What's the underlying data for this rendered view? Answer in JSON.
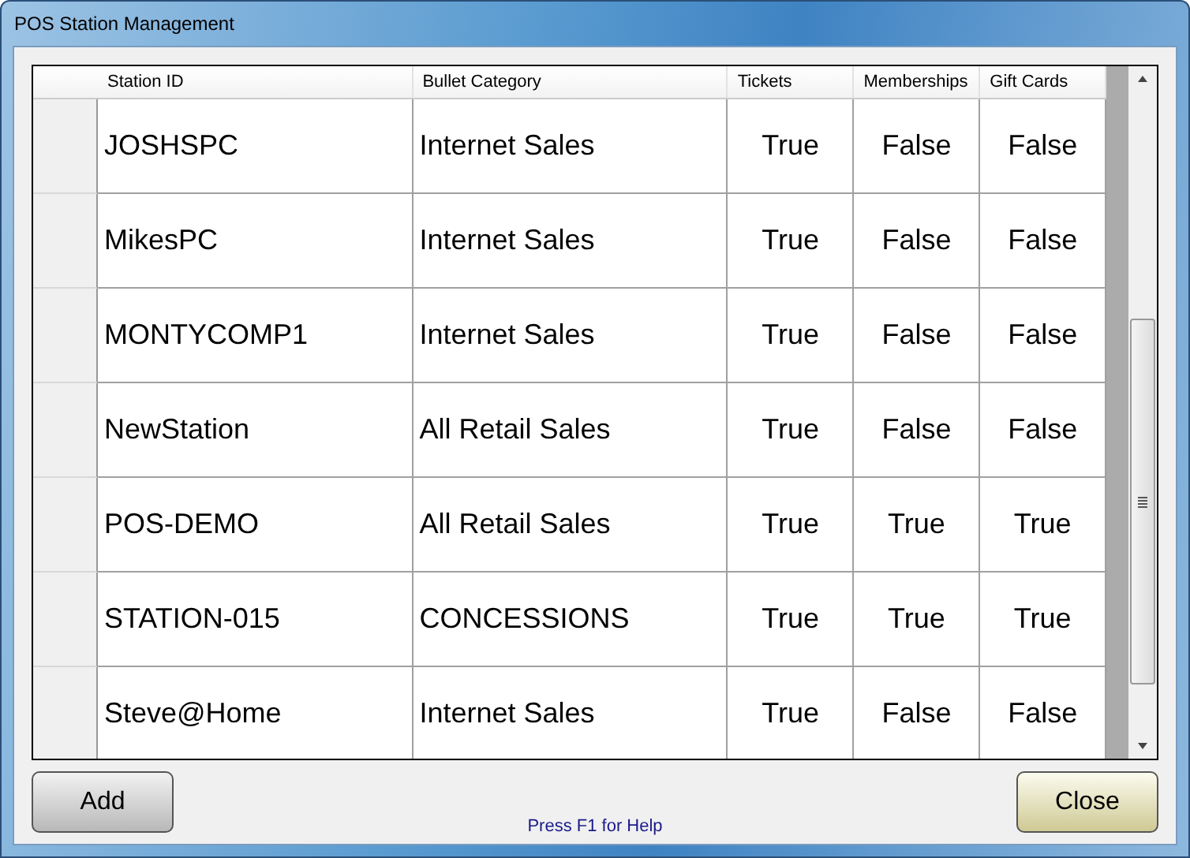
{
  "window": {
    "title": "POS Station Management"
  },
  "table": {
    "columns": [
      "Station ID",
      "Bullet Category",
      "Tickets",
      "Memberships",
      "Gift Cards"
    ],
    "rows": [
      [
        "JOSHSPC",
        "Internet Sales",
        "True",
        "False",
        "False"
      ],
      [
        "MikesPC",
        "Internet Sales",
        "True",
        "False",
        "False"
      ],
      [
        "MONTYCOMP1",
        "Internet Sales",
        "True",
        "False",
        "False"
      ],
      [
        "NewStation",
        "All Retail Sales",
        "True",
        "False",
        "False"
      ],
      [
        "POS-DEMO",
        "All Retail Sales",
        "True",
        "True",
        "True"
      ],
      [
        "STATION-015",
        "CONCESSIONS",
        "True",
        "True",
        "True"
      ],
      [
        "Steve@Home",
        "Internet Sales",
        "True",
        "False",
        "False"
      ]
    ]
  },
  "buttons": [
    {
      "label": "Add",
      "kind": "plain"
    },
    {
      "label": "Close",
      "kind": "accent"
    }
  ],
  "help": "Press F1 for Help"
}
